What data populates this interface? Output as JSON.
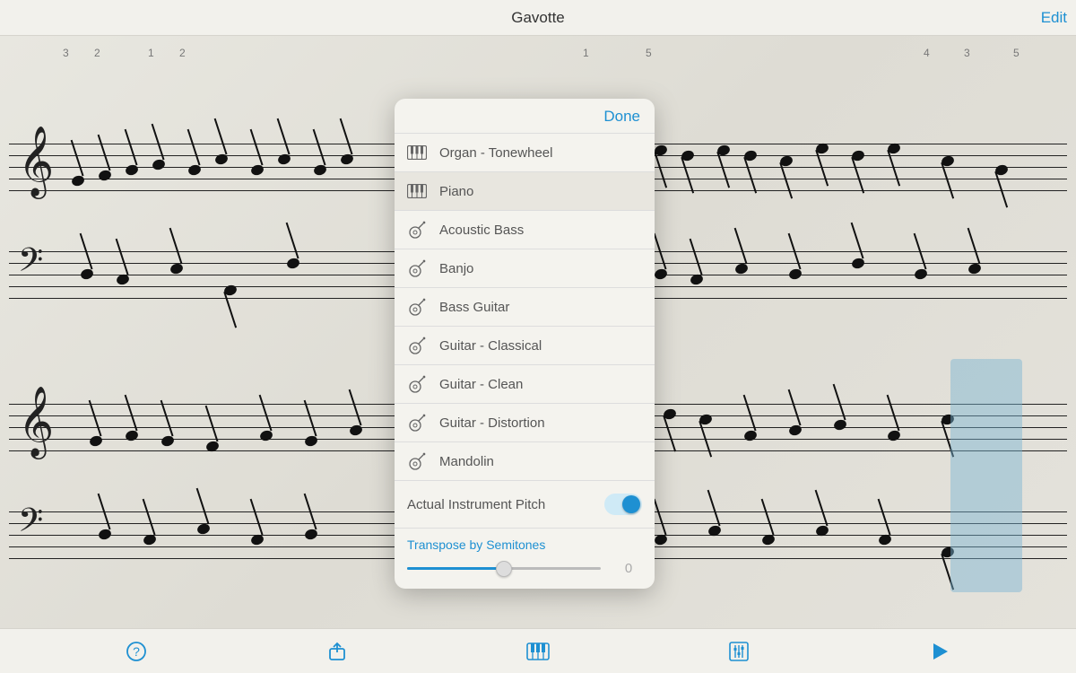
{
  "header": {
    "title": "Gavotte",
    "edit": "Edit"
  },
  "popover": {
    "done": "Done",
    "instruments": [
      {
        "label": "Organ - Tonewheel",
        "icon": "keyboard",
        "selected": false
      },
      {
        "label": "Piano",
        "icon": "keyboard",
        "selected": true
      },
      {
        "label": "Acoustic Bass",
        "icon": "string",
        "selected": false
      },
      {
        "label": "Banjo",
        "icon": "string",
        "selected": false
      },
      {
        "label": "Bass Guitar",
        "icon": "string",
        "selected": false
      },
      {
        "label": "Guitar - Classical",
        "icon": "string",
        "selected": false
      },
      {
        "label": "Guitar - Clean",
        "icon": "string",
        "selected": false
      },
      {
        "label": "Guitar - Distortion",
        "icon": "string",
        "selected": false
      },
      {
        "label": "Mandolin",
        "icon": "string",
        "selected": false
      }
    ],
    "pitch_label": "Actual Instrument Pitch",
    "pitch_on": true,
    "transpose_label": "Transpose by Semitones",
    "transpose_value": "0"
  },
  "bottom": {
    "help": "help",
    "share": "share",
    "instrument": "instrument",
    "mixer": "mixer",
    "play": "play"
  },
  "fingerings_top": [
    "3",
    "2",
    "1",
    "2",
    "1",
    "5",
    "4",
    "3",
    "5"
  ]
}
